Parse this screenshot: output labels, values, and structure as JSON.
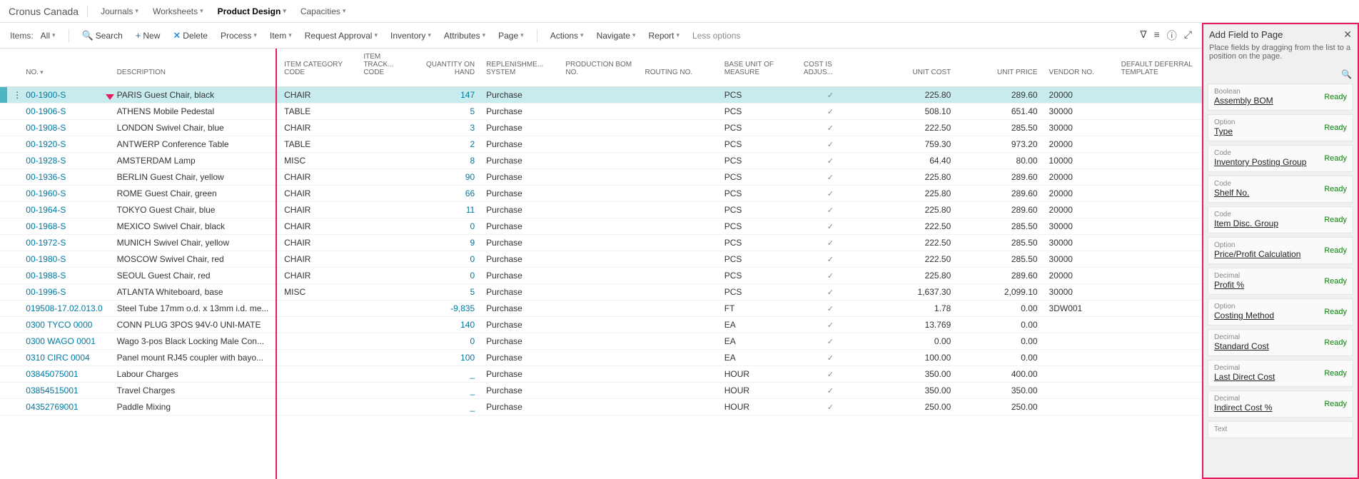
{
  "brand": "Cronus Canada",
  "topTabs": [
    {
      "label": "Journals"
    },
    {
      "label": "Worksheets"
    },
    {
      "label": "Product Design",
      "active": true
    },
    {
      "label": "Capacities"
    }
  ],
  "toolbar": {
    "itemsLabel": "Items:",
    "filter": "All",
    "search": "Search",
    "new": "New",
    "delete": "Delete",
    "process": "Process",
    "item": "Item",
    "requestApproval": "Request Approval",
    "inventory": "Inventory",
    "attributes": "Attributes",
    "page": "Page",
    "actions": "Actions",
    "navigate": "Navigate",
    "report": "Report",
    "less": "Less options"
  },
  "columns": {
    "no": "NO.",
    "description": "DESCRIPTION",
    "itemCategory": "ITEM CATEGORY CODE",
    "itemTrack": "ITEM TRACK... CODE",
    "qty": "QUANTITY ON HAND",
    "replen": "REPLENISHME... SYSTEM",
    "prodBom": "PRODUCTION BOM NO.",
    "routing": "ROUTING NO.",
    "baseUnit": "BASE UNIT OF MEASURE",
    "costAdj": "COST IS ADJUS...",
    "unitCost": "UNIT COST",
    "unitPrice": "UNIT PRICE",
    "vendor": "VENDOR NO.",
    "deferral": "DEFAULT DEFERRAL TEMPLATE"
  },
  "rows": [
    {
      "no": "00-1900-S",
      "desc": "PARIS Guest Chair, black",
      "cat": "CHAIR",
      "qty": "147",
      "replen": "Purchase",
      "uom": "PCS",
      "adj": true,
      "cost": "225.80",
      "price": "289.60",
      "vendor": "20000",
      "selected": true
    },
    {
      "no": "00-1906-S",
      "desc": "ATHENS Mobile Pedestal",
      "cat": "TABLE",
      "qty": "5",
      "replen": "Purchase",
      "uom": "PCS",
      "adj": true,
      "cost": "508.10",
      "price": "651.40",
      "vendor": "30000"
    },
    {
      "no": "00-1908-S",
      "desc": "LONDON Swivel Chair, blue",
      "cat": "CHAIR",
      "qty": "3",
      "replen": "Purchase",
      "uom": "PCS",
      "adj": true,
      "cost": "222.50",
      "price": "285.50",
      "vendor": "30000"
    },
    {
      "no": "00-1920-S",
      "desc": "ANTWERP Conference Table",
      "cat": "TABLE",
      "qty": "2",
      "replen": "Purchase",
      "uom": "PCS",
      "adj": true,
      "cost": "759.30",
      "price": "973.20",
      "vendor": "20000"
    },
    {
      "no": "00-1928-S",
      "desc": "AMSTERDAM Lamp",
      "cat": "MISC",
      "qty": "8",
      "replen": "Purchase",
      "uom": "PCS",
      "adj": true,
      "cost": "64.40",
      "price": "80.00",
      "vendor": "10000"
    },
    {
      "no": "00-1936-S",
      "desc": "BERLIN Guest Chair, yellow",
      "cat": "CHAIR",
      "qty": "90",
      "replen": "Purchase",
      "uom": "PCS",
      "adj": true,
      "cost": "225.80",
      "price": "289.60",
      "vendor": "20000"
    },
    {
      "no": "00-1960-S",
      "desc": "ROME Guest Chair, green",
      "cat": "CHAIR",
      "qty": "66",
      "replen": "Purchase",
      "uom": "PCS",
      "adj": true,
      "cost": "225.80",
      "price": "289.60",
      "vendor": "20000"
    },
    {
      "no": "00-1964-S",
      "desc": "TOKYO Guest Chair, blue",
      "cat": "CHAIR",
      "qty": "11",
      "replen": "Purchase",
      "uom": "PCS",
      "adj": true,
      "cost": "225.80",
      "price": "289.60",
      "vendor": "20000"
    },
    {
      "no": "00-1968-S",
      "desc": "MEXICO Swivel Chair, black",
      "cat": "CHAIR",
      "qty": "0",
      "replen": "Purchase",
      "uom": "PCS",
      "adj": true,
      "cost": "222.50",
      "price": "285.50",
      "vendor": "30000"
    },
    {
      "no": "00-1972-S",
      "desc": "MUNICH Swivel Chair, yellow",
      "cat": "CHAIR",
      "qty": "9",
      "replen": "Purchase",
      "uom": "PCS",
      "adj": true,
      "cost": "222.50",
      "price": "285.50",
      "vendor": "30000"
    },
    {
      "no": "00-1980-S",
      "desc": "MOSCOW Swivel Chair, red",
      "cat": "CHAIR",
      "qty": "0",
      "replen": "Purchase",
      "uom": "PCS",
      "adj": true,
      "cost": "222.50",
      "price": "285.50",
      "vendor": "30000"
    },
    {
      "no": "00-1988-S",
      "desc": "SEOUL Guest Chair, red",
      "cat": "CHAIR",
      "qty": "0",
      "replen": "Purchase",
      "uom": "PCS",
      "adj": true,
      "cost": "225.80",
      "price": "289.60",
      "vendor": "20000"
    },
    {
      "no": "00-1996-S",
      "desc": "ATLANTA Whiteboard, base",
      "cat": "MISC",
      "qty": "5",
      "replen": "Purchase",
      "uom": "PCS",
      "adj": true,
      "cost": "1,637.30",
      "price": "2,099.10",
      "vendor": "30000"
    },
    {
      "no": "019508-17.02.013.0",
      "desc": "Steel Tube 17mm o.d. x 13mm i.d. me...",
      "cat": "",
      "qty": "-9,835",
      "replen": "Purchase",
      "uom": "FT",
      "adj": true,
      "cost": "1.78",
      "price": "0.00",
      "vendor": "3DW001"
    },
    {
      "no": "0300 TYCO 0000",
      "desc": "CONN PLUG 3POS 94V-0 UNI-MATE",
      "cat": "",
      "qty": "140",
      "replen": "Purchase",
      "uom": "EA",
      "adj": true,
      "cost": "13.769",
      "price": "0.00",
      "vendor": ""
    },
    {
      "no": "0300 WAGO 0001",
      "desc": "Wago 3-pos Black Locking Male Con...",
      "cat": "",
      "qty": "0",
      "replen": "Purchase",
      "uom": "EA",
      "adj": true,
      "cost": "0.00",
      "price": "0.00",
      "vendor": ""
    },
    {
      "no": "0310 CIRC 0004",
      "desc": "Panel mount RJ45 coupler with bayo...",
      "cat": "",
      "qty": "100",
      "replen": "Purchase",
      "uom": "EA",
      "adj": true,
      "cost": "100.00",
      "price": "0.00",
      "vendor": ""
    },
    {
      "no": "03845075001",
      "desc": "Labour Charges",
      "cat": "",
      "qty": "_",
      "replen": "Purchase",
      "uom": "HOUR",
      "adj": true,
      "cost": "350.00",
      "price": "400.00",
      "vendor": ""
    },
    {
      "no": "03854515001",
      "desc": "Travel Charges",
      "cat": "",
      "qty": "_",
      "replen": "Purchase",
      "uom": "HOUR",
      "adj": true,
      "cost": "350.00",
      "price": "350.00",
      "vendor": ""
    },
    {
      "no": "04352769001",
      "desc": "Paddle Mixing",
      "cat": "",
      "qty": "_",
      "replen": "Purchase",
      "uom": "HOUR",
      "adj": true,
      "cost": "250.00",
      "price": "250.00",
      "vendor": ""
    }
  ],
  "sidePanel": {
    "title": "Add Field to Page",
    "subtitle": "Place fields by dragging from the list to a position on the page.",
    "fields": [
      {
        "type": "Boolean",
        "name": "Assembly BOM",
        "status": "Ready"
      },
      {
        "type": "Option",
        "name": "Type",
        "status": "Ready"
      },
      {
        "type": "Code",
        "name": "Inventory Posting Group",
        "status": "Ready"
      },
      {
        "type": "Code",
        "name": "Shelf No.",
        "status": "Ready"
      },
      {
        "type": "Code",
        "name": "Item Disc. Group",
        "status": "Ready"
      },
      {
        "type": "Option",
        "name": "Price/Profit Calculation",
        "status": "Ready"
      },
      {
        "type": "Decimal",
        "name": "Profit %",
        "status": "Ready"
      },
      {
        "type": "Option",
        "name": "Costing Method",
        "status": "Ready"
      },
      {
        "type": "Decimal",
        "name": "Standard Cost",
        "status": "Ready"
      },
      {
        "type": "Decimal",
        "name": "Last Direct Cost",
        "status": "Ready"
      },
      {
        "type": "Decimal",
        "name": "Indirect Cost %",
        "status": "Ready"
      },
      {
        "type": "Text",
        "name": "",
        "status": ""
      }
    ]
  }
}
